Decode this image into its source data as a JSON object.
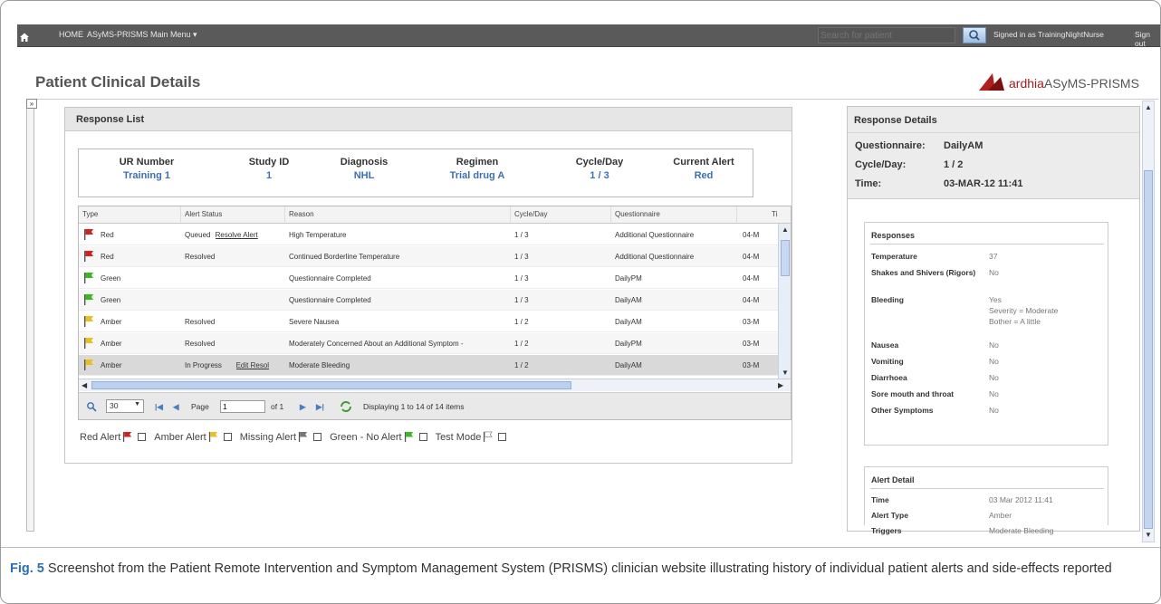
{
  "navbar": {
    "home": "HOME",
    "menu": "ASyMS-PRISMS Main Menu ▾",
    "search_placeholder": "Search for patient",
    "signed_in": "Signed in as TrainingNightNurse",
    "sign_out": "Sign out"
  },
  "page_title": "Patient Clinical Details",
  "logo": {
    "brand": "ardhia",
    "product": "ASyMS-PRISMS"
  },
  "response_list": {
    "title": "Response List",
    "summary": [
      {
        "label": "UR Number",
        "value": "Training 1"
      },
      {
        "label": "Study ID",
        "value": "1"
      },
      {
        "label": "Diagnosis",
        "value": "NHL"
      },
      {
        "label": "Regimen",
        "value": "Trial drug A"
      },
      {
        "label": "Cycle/Day",
        "value": "1 / 3"
      },
      {
        "label": "Current Alert",
        "value": "Red"
      }
    ],
    "columns": [
      "Type",
      "Alert Status",
      "Reason",
      "Cycle/Day",
      "Questionnaire",
      "Ti"
    ],
    "rows": [
      {
        "flag": "red",
        "type": "Red",
        "status": "Queued",
        "action": "Resolve Alert",
        "reason": "High Temperature",
        "cycle": "1 / 3",
        "questionnaire": "Additional Questionnaire",
        "time": "04-M"
      },
      {
        "flag": "red",
        "type": "Red",
        "status": "Resolved",
        "action": "",
        "reason": "Continued Borderline Temperature",
        "cycle": "1 / 3",
        "questionnaire": "Additional Questionnaire",
        "time": "04-M"
      },
      {
        "flag": "green",
        "type": "Green",
        "status": "",
        "action": "",
        "reason": "Questionnaire Completed",
        "cycle": "1 / 3",
        "questionnaire": "DailyPM",
        "time": "04-M"
      },
      {
        "flag": "green",
        "type": "Green",
        "status": "",
        "action": "",
        "reason": "Questionnaire Completed",
        "cycle": "1 / 3",
        "questionnaire": "DailyAM",
        "time": "04-M"
      },
      {
        "flag": "amber",
        "type": "Amber",
        "status": "Resolved",
        "action": "",
        "reason": "Severe Nausea",
        "cycle": "1 / 2",
        "questionnaire": "DailyAM",
        "time": "03-M"
      },
      {
        "flag": "amber",
        "type": "Amber",
        "status": "Resolved",
        "action": "",
        "reason": "Moderately Concerned About an Additional Symptom -",
        "cycle": "1 / 2",
        "questionnaire": "DailyPM",
        "time": "03-M"
      },
      {
        "flag": "amber",
        "type": "Amber",
        "status": "In Progress",
        "action": "Edit Resol",
        "reason": "Moderate Bleeding",
        "cycle": "1 / 2",
        "questionnaire": "DailyAM",
        "time": "03-M"
      }
    ],
    "pager": {
      "page_size": "30",
      "page_label": "Page",
      "page_value": "1",
      "of_label": "of 1",
      "display_text": "Displaying 1 to 14 of 14 items"
    },
    "legend": [
      {
        "label": "Red Alert",
        "flag": "red"
      },
      {
        "label": "Amber Alert",
        "flag": "amber"
      },
      {
        "label": "Missing Alert",
        "flag": "grey"
      },
      {
        "label": "Green - No Alert",
        "flag": "green"
      },
      {
        "label": "Test Mode",
        "flag": "white"
      }
    ]
  },
  "response_details": {
    "title": "Response Details",
    "questionnaire_label": "Questionnaire:",
    "questionnaire_value": "DailyAM",
    "cycle_label": "Cycle/Day:",
    "cycle_value": "1 / 2",
    "time_label": "Time:",
    "time_value": "03-MAR-12 11:41",
    "responses_title": "Responses",
    "responses": [
      {
        "label": "Temperature",
        "value": "37"
      },
      {
        "label": "Shakes and Shivers (Rigors)",
        "value": "No"
      },
      {
        "label": "Bleeding",
        "value": "Yes",
        "extra1": "Severity = Moderate",
        "extra2": "Bother = A little"
      },
      {
        "label": "Nausea",
        "value": "No"
      },
      {
        "label": "Vomiting",
        "value": "No"
      },
      {
        "label": "Diarrhoea",
        "value": "No"
      },
      {
        "label": "Sore mouth and throat",
        "value": "No"
      },
      {
        "label": "Other Symptoms",
        "value": "No"
      }
    ],
    "alert_title": "Alert Detail",
    "alert": [
      {
        "label": "Time",
        "value": "03 Mar 2012 11:41"
      },
      {
        "label": "Alert Type",
        "value": "Amber"
      },
      {
        "label": "Triggers",
        "value": "Moderate Bleeding"
      }
    ]
  },
  "caption": {
    "label": "Fig. 5",
    "text": "Screenshot from the Patient Remote Intervention and Symptom Management System (PRISMS) clinician website illustrating history of individual patient alerts and side-effects reported"
  },
  "colors": {
    "red_flag": "#d42020",
    "green_flag": "#3cb81e",
    "amber_flag": "#e8c020",
    "grey_flag": "#777777",
    "link_blue": "#3a70b4"
  }
}
